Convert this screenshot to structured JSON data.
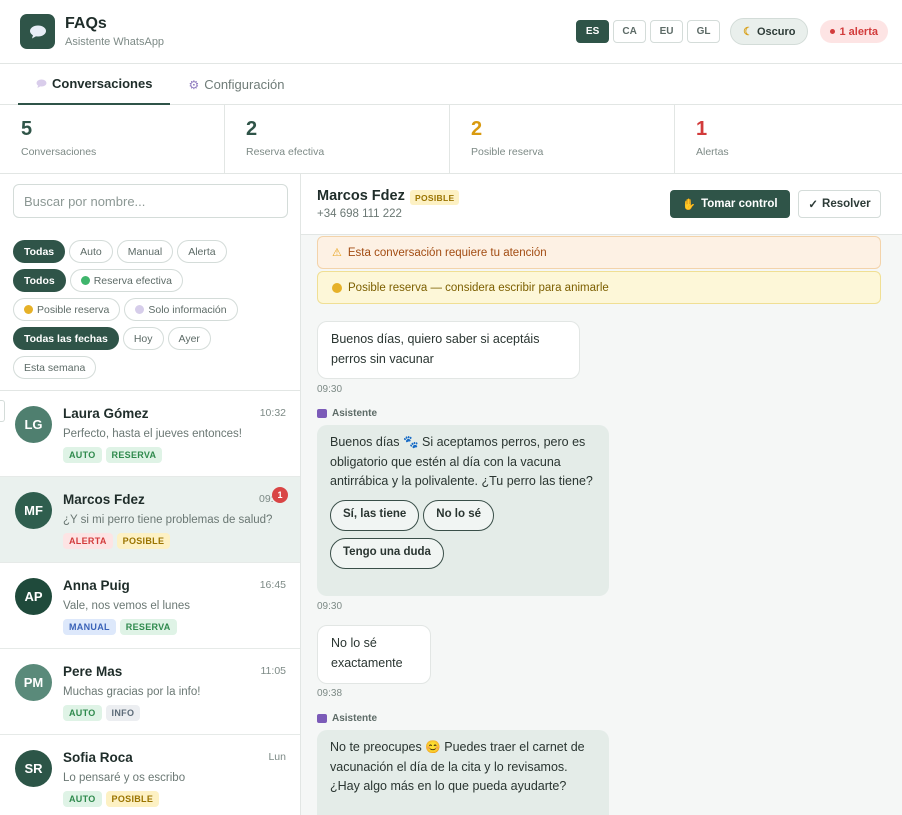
{
  "header": {
    "title": "FAQs",
    "subtitle": "Asistente WhatsApp",
    "languages": [
      "ES",
      "CA",
      "EU",
      "GL"
    ],
    "active_language": "ES",
    "dark_label": "Oscuro",
    "alert_label": "1 alerta"
  },
  "tabs": [
    {
      "label": "Conversaciones",
      "icon": "speech-bubble-icon"
    },
    {
      "label": "Configuración",
      "icon": "gear-icon"
    }
  ],
  "stats": [
    {
      "value": "5",
      "label": "Conversaciones",
      "color": "#2f5448"
    },
    {
      "value": "2",
      "label": "Reserva efectiva",
      "color": "#2f5448"
    },
    {
      "value": "2",
      "label": "Posible reserva",
      "color": "#d99a0f"
    },
    {
      "value": "1",
      "label": "Alertas",
      "color": "#d23b3b"
    }
  ],
  "sidebar": {
    "search_placeholder": "Buscar por nombre...",
    "filters": {
      "mode": [
        "Todas",
        "Auto",
        "Manual",
        "Alerta"
      ],
      "outcome": [
        "Todos",
        "Reserva efectiva",
        "Posible reserva",
        "Solo información"
      ],
      "date": [
        "Todas las fechas",
        "Hoy",
        "Ayer",
        "Esta semana"
      ]
    },
    "conversations": [
      {
        "initials": "LG",
        "name": "Laura Gómez",
        "time": "10:32",
        "preview": "Perfecto, hasta el jueves entonces!",
        "tags": [
          "AUTO",
          "RESERVA"
        ],
        "avatar_color": "#4f7f6f"
      },
      {
        "initials": "MF",
        "name": "Marcos Fdez",
        "time": "09:",
        "preview": "¿Y si mi perro tiene problemas de salud?",
        "tags": [
          "ALERTA",
          "POSIBLE"
        ],
        "avatar_color": "#2f5e4e",
        "badge": "1"
      },
      {
        "initials": "AP",
        "name": "Anna Puig",
        "time": "16:45",
        "preview": "Vale, nos vemos el lunes",
        "tags": [
          "MANUAL",
          "RESERVA"
        ],
        "avatar_color": "#1f4a3b"
      },
      {
        "initials": "PM",
        "name": "Pere Mas",
        "time": "11:05",
        "preview": "Muchas gracias por la info!",
        "tags": [
          "AUTO",
          "INFO"
        ],
        "avatar_color": "#5a8a7a"
      },
      {
        "initials": "SR",
        "name": "Sofia Roca",
        "time": "Lun",
        "preview": "Lo pensaré y os escribo",
        "tags": [
          "AUTO",
          "POSIBLE"
        ],
        "avatar_color": "#2c5547"
      }
    ]
  },
  "chat": {
    "contact_name": "Marcos Fdez",
    "contact_badge": "POSIBLE",
    "contact_phone": "+34 698 111 222",
    "take_control_label": "Tomar control",
    "resolve_label": "Resolver",
    "banner_attention": "Esta conversación requiere tu atención",
    "banner_possible": "Posible reserva — considera escribir para animarle",
    "assistant_label": "Asistente",
    "messages": {
      "m1": {
        "text": "Buenos días, quiero saber si aceptáis perros sin vacunar",
        "time": "09:30"
      },
      "m2": {
        "text": "Buenos días 🐾 Si aceptamos perros, pero es obligatorio que estén al día con la vacuna antirrábica y la polivalente. ¿Tu perro las tiene?",
        "time": "09:30",
        "quick_replies": [
          "Sí, las tiene",
          "No lo sé",
          "Tengo una duda"
        ]
      },
      "m3": {
        "text": "No lo sé exactamente",
        "time": "09:38"
      },
      "m4": {
        "text": "No te preocupes 😊 Puedes traer el carnet de vacunación el día de la cita y lo revisamos. ¿Hay algo más en lo que pueda ayudarte?"
      }
    }
  }
}
